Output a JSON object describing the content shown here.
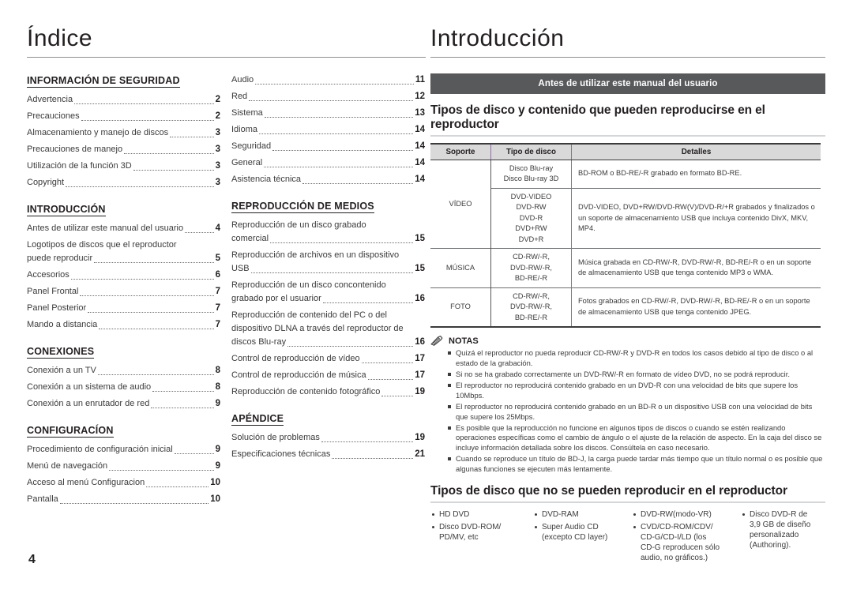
{
  "page_number": "4",
  "left": {
    "title": "Índice",
    "columns": [
      {
        "groups": [
          {
            "title": "INFORMACIÓN DE SEGURIDAD",
            "entries": [
              {
                "label": "Advertencia",
                "page": "2"
              },
              {
                "label": "Precauciones",
                "page": "2"
              },
              {
                "label": "Almacenamiento y manejo de discos",
                "page": "3"
              },
              {
                "label": "Precauciones de manejo",
                "page": "3"
              },
              {
                "label": "Utilización de la función 3D",
                "page": "3"
              },
              {
                "label": "Copyright",
                "page": "3"
              }
            ]
          },
          {
            "title": "INTRODUCCIÓN",
            "entries": [
              {
                "label": "Antes de utilizar este manual del usuario",
                "page": "4"
              },
              {
                "first_line": "Logotipos de discos que el reproductor",
                "label": "puede reproducir",
                "page": "5"
              },
              {
                "label": "Accesorios",
                "page": "6"
              },
              {
                "label": "Panel Frontal",
                "page": "7"
              },
              {
                "label": "Panel Posterior",
                "page": "7"
              },
              {
                "label": "Mando a distancia",
                "page": "7"
              }
            ]
          },
          {
            "title": "CONEXIONES",
            "entries": [
              {
                "label": "Conexión a un TV",
                "page": "8"
              },
              {
                "label": "Conexión a un sistema de audio",
                "page": "8"
              },
              {
                "label": "Conexión a un enrutador de red",
                "page": "9"
              }
            ]
          },
          {
            "title": "CONFIGURACÍON",
            "entries": [
              {
                "label": "Procedimiento de configuración inicial",
                "page": "9"
              },
              {
                "label": "Menú de navegación",
                "page": "9"
              },
              {
                "label": "Acceso al menú Configuracion",
                "page": "10"
              },
              {
                "label": "Pantalla",
                "page": "10"
              }
            ]
          }
        ]
      },
      {
        "groups": [
          {
            "title": "",
            "entries": [
              {
                "label": "Audio",
                "page": "11"
              },
              {
                "label": "Red",
                "page": "12"
              },
              {
                "label": "Sistema",
                "page": "13"
              },
              {
                "label": "Idioma",
                "page": "14"
              },
              {
                "label": "Seguridad",
                "page": "14"
              },
              {
                "label": "General",
                "page": "14"
              },
              {
                "label": "Asistencia técnica",
                "page": "14"
              }
            ]
          },
          {
            "title": "REPRODUCCIÓN DE MEDIOS",
            "entries": [
              {
                "first_line": "Reproducción de un disco grabado",
                "label": "comercial",
                "page": "15"
              },
              {
                "first_line": "Reproducción de archivos en un dispositivo",
                "label": "USB",
                "page": "15"
              },
              {
                "first_line": "Reproducción de un disco concontenido",
                "label": "grabado por el usuarior",
                "page": "16"
              },
              {
                "first_line": "Reproducción de contenido del PC o del\ndispositivo DLNA a través del reproductor de",
                "label": "discos Blu-ray",
                "page": "16"
              },
              {
                "label": "Control de reproducción de vídeo",
                "page": "17"
              },
              {
                "label": "Control de reproducción de música",
                "page": "17"
              },
              {
                "label": "Reproducción de contenido fotográfico",
                "page": "19"
              }
            ]
          },
          {
            "title": "APÉNDICE",
            "entries": [
              {
                "label": "Solución de problemas",
                "page": "19"
              },
              {
                "label": "Especificaciones técnicas",
                "page": "21"
              }
            ]
          }
        ]
      }
    ]
  },
  "right": {
    "title": "Introducción",
    "banner": "Antes de utilizar este manual del usuario",
    "section_heading": "Tipos de disco y contenido que pueden reproducirse en el reproductor",
    "table": {
      "headers": [
        "Soporte",
        "Tipo de disco",
        "Detalles"
      ],
      "rows": [
        {
          "media": "VÍDEO",
          "subrows": [
            {
              "kind": "Disco Blu-ray\nDisco Blu-ray 3D",
              "detail": "BD-ROM o BD-RE/-R grabado en formato BD-RE."
            },
            {
              "kind": "DVD-VIDEO\nDVD-RW\nDVD-R\nDVD+RW\nDVD+R",
              "detail": "DVD-VIDEO, DVD+RW/DVD-RW(V)/DVD-R/+R grabados y finalizados o un soporte de almacenamiento USB que incluya contenido DivX, MKV, MP4."
            }
          ]
        },
        {
          "media": "MÚSICA",
          "subrows": [
            {
              "kind": "CD-RW/-R,\nDVD-RW/-R,\nBD-RE/-R",
              "detail": "Música grabada en CD-RW/-R, DVD-RW/-R, BD-RE/-R o en un soporte de almacenamiento USB que tenga contenido MP3 o WMA."
            }
          ]
        },
        {
          "media": "FOTO",
          "subrows": [
            {
              "kind": "CD-RW/-R,\nDVD-RW/-R,\nBD-RE/-R",
              "detail": "Fotos grabados en CD-RW/-R, DVD-RW/-R, BD-RE/-R o en un soporte de almacenamiento USB que tenga contenido JPEG."
            }
          ]
        }
      ]
    },
    "notes": {
      "title": "NOTAS",
      "items": [
        "Quizá el reproductor no pueda reproducir CD-RW/-R y DVD-R en todos los casos debido al tipo de disco o al estado de la grabación.",
        "Si no se ha grabado correctamente un DVD-RW/-R en formato de vídeo DVD, no se podrá reproducir.",
        "El reproductor no reproducirá contenido grabado en un DVD-R con una velocidad de bits que supere los 10Mbps.",
        "El reproductor no reproducirá contenido grabado en un BD-R o un dispositivo USB con una velocidad de bits que supere los 25Mbps.",
        "Es posible que la reproducción no funcione en algunos tipos de discos o cuando se estén realizando operaciones específicas como el cambio de ángulo o el ajuste de la relación de aspecto. En la caja del disco se incluye información detallada sobre los discos. Consúltela en caso necesario.",
        "Cuando se reproduce un título de BD-J, la carga puede tardar más tiempo que un título normal o es posible que algunas funciones se ejecuten más lentamente."
      ]
    },
    "bottom_heading": "Tipos de disco que no se pueden reproducir en el reproductor",
    "unsupported": [
      [
        "HD DVD",
        "Disco DVD-ROM/\nPD/MV, etc"
      ],
      [
        "DVD-RAM",
        "Super Audio CD\n(excepto CD layer)"
      ],
      [
        "DVD-RW(modo-VR)",
        "CVD/CD-ROM/CDV/\nCD-G/CD-I/LD  (los\nCD-G reproducen sólo\naudio, no gráficos.)"
      ],
      [
        "Disco DVD-R de\n3,9 GB de diseño\npersonalizado\n(Authoring)."
      ]
    ]
  },
  "colors": {
    "banner_bg": "#58595b",
    "table_header_bg": "#d9d9d9",
    "accent_divider": "#8b6fa0",
    "text": "#231f20"
  }
}
